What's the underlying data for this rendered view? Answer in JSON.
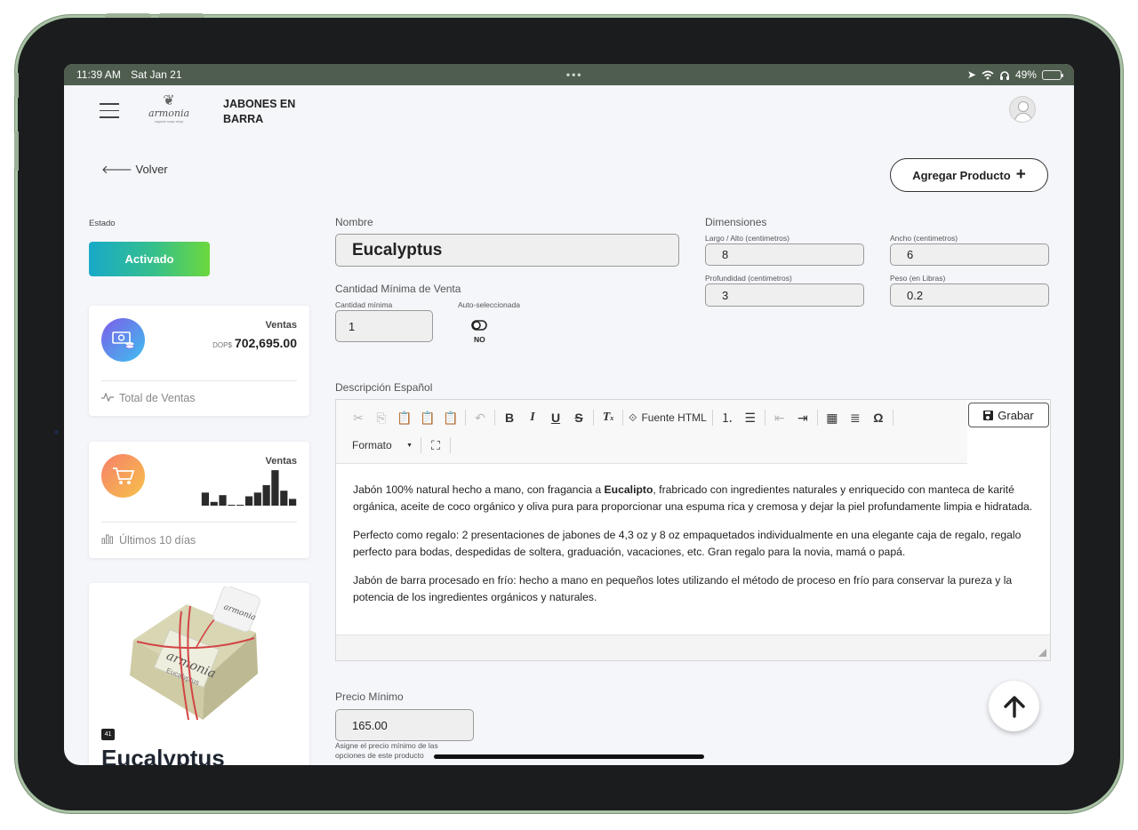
{
  "status": {
    "time": "11:39 AM",
    "date": "Sat Jan 21",
    "battery": "49%"
  },
  "header": {
    "logo_name": "armonia",
    "logo_tagline": "organic soap shop",
    "title": "JABONES EN BARRA"
  },
  "nav": {
    "back_label": "Volver",
    "add_product_label": "Agregar Producto"
  },
  "estado": {
    "label": "Estado",
    "button": "Activado"
  },
  "stats": {
    "sales_total": {
      "label": "Ventas",
      "currency": "DOP$",
      "amount": "702,695.00",
      "footer": "Total de Ventas"
    },
    "sales_recent": {
      "label": "Ventas",
      "footer": "Últimos 10 días",
      "bars": [
        0.35,
        0.1,
        0.28,
        0.02,
        0.02,
        0.25,
        0.35,
        0.55,
        0.95,
        0.4,
        0.18
      ]
    }
  },
  "product_card": {
    "badge": "41",
    "name": "Eucalyptus",
    "image_label_brand": "armonia",
    "image_label_variant": "Eucalyptus"
  },
  "form": {
    "nombre": {
      "label": "Nombre",
      "value": "Eucalyptus"
    },
    "cantidad": {
      "label": "Cantidad Mínima de Venta",
      "min_label": "Cantidad mínima",
      "min_value": "1",
      "auto_label": "Auto-seleccionada",
      "auto_value": "NO"
    },
    "dimensiones": {
      "label": "Dimensiones",
      "largo_label": "Largo / Alto (centimetros)",
      "largo_value": "8",
      "ancho_label": "Ancho (centimetros)",
      "ancho_value": "6",
      "profundidad_label": "Profundidad (centimetros)",
      "profundidad_value": "3",
      "peso_label": "Peso (en Libras)",
      "peso_value": "0.2"
    },
    "descripcion": {
      "label": "Descripción Español",
      "save_label": "Grabar",
      "toolbar": {
        "source_label": "Fuente HTML",
        "format_label": "Formato"
      },
      "p1_pre": "Jabón 100% natural hecho a mano, con fragancia a ",
      "p1_bold": "Eucalipto",
      "p1_post": ", frabricado con  ingredientes naturales y enriquecido con manteca de karité orgánica, aceite de coco orgánico y oliva pura para proporcionar una espuma rica y cremosa y dejar la piel profundamente limpia e hidratada.",
      "p2": "Perfecto como regalo: 2 presentaciones de jabones de 4,3 oz y 8 oz empaquetados individualmente en una elegante caja de regalo, regalo perfecto para bodas, despedidas de soltera, graduación, vacaciones, etc. Gran regalo para la novia, mamá o papá.",
      "p3": "Jabón de barra procesado en frío: hecho a mano en pequeños lotes utilizando el método de proceso en frío para conservar la pureza y la potencia de los ingredientes orgánicos y naturales."
    },
    "precio": {
      "label": "Precio Mínimo",
      "value": "165.00",
      "help": "Asigne el precio mínimo de las opciones de este producto"
    }
  }
}
